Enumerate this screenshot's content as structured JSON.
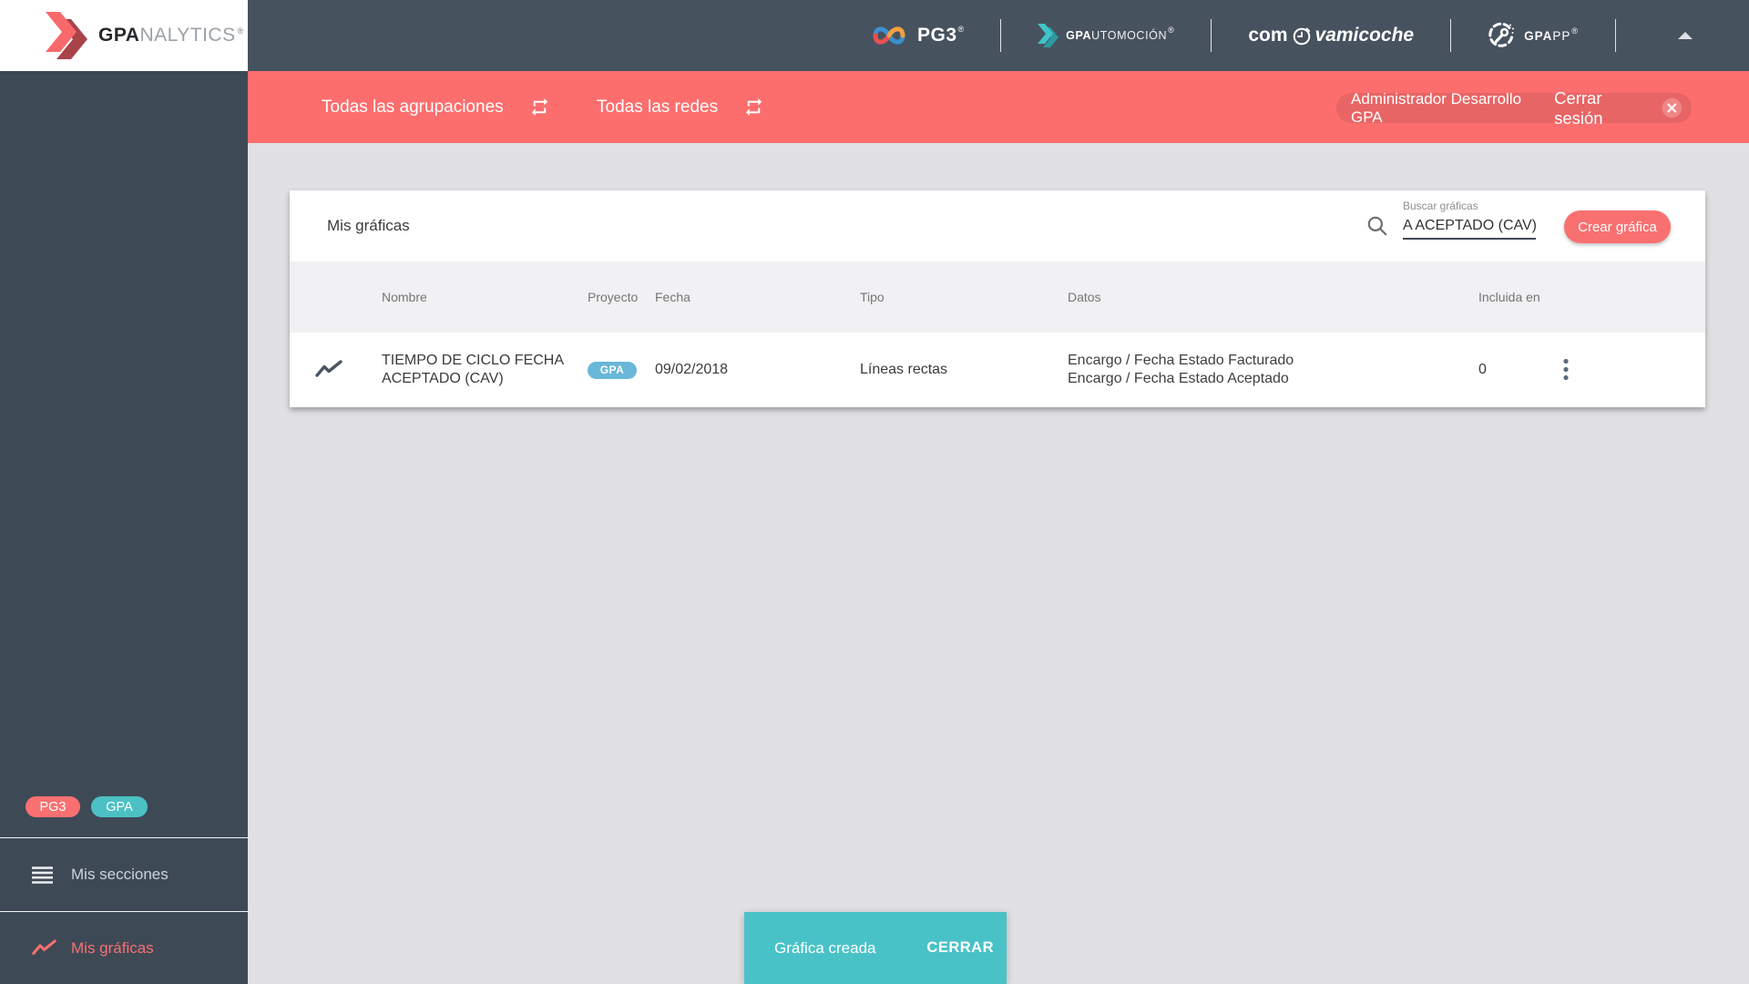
{
  "topbar": {
    "brand": {
      "bold": "GPA",
      "light": "NALYTICS",
      "reg": "®"
    },
    "pg3": {
      "label": "PG3",
      "reg": "®"
    },
    "gpautomocion": {
      "bold": "GPA",
      "light": "UTOMOCIÓN",
      "reg": "®"
    },
    "comprovamicoche": {
      "pre": "com",
      "post": "vamicoche"
    },
    "gpapp": {
      "bold": "GPA",
      "light": "PP",
      "reg": "®"
    }
  },
  "filterbar": {
    "groupings": "Todas las agrupaciones",
    "networks": "Todas las redes",
    "user": "Administrador Desarrollo GPA",
    "logout": "Cerrar sesión"
  },
  "sidebar": {
    "badges": [
      {
        "label": "PG3"
      },
      {
        "label": "GPA"
      }
    ],
    "items": [
      {
        "label": "Mis secciones"
      },
      {
        "label": "Mis gráficas"
      }
    ]
  },
  "card": {
    "title": "Mis gráficas",
    "search": {
      "label": "Buscar gráficas",
      "value": "A ACEPTADO (CAV)"
    },
    "create_button": "Crear gráfica",
    "table": {
      "headers": [
        "Nombre",
        "Proyecto",
        "Fecha",
        "Tipo",
        "Datos",
        "Incluida en"
      ],
      "rows": [
        {
          "name": [
            "TIEMPO DE CICLO FECHA",
            "ACEPTADO (CAV)"
          ],
          "project_badge": "GPA",
          "date": "09/02/2018",
          "type": "Líneas rectas",
          "data": [
            "Encargo / Fecha Estado Facturado",
            "Encargo / Fecha Estado Aceptado"
          ],
          "included_in": "0"
        }
      ]
    }
  },
  "snackbar": {
    "message": "Gráfica creada",
    "action": "CERRAR"
  },
  "colors": {
    "topbar": "#47525f",
    "sidebar": "#3e4956",
    "accent_red": "#fc6e6e",
    "button_red": "#f97070",
    "snackbar_teal": "#49c2c7",
    "badge_teal": "#4cc1c5",
    "badge_blue": "#69b7d9",
    "background": "#e1e1e3"
  }
}
